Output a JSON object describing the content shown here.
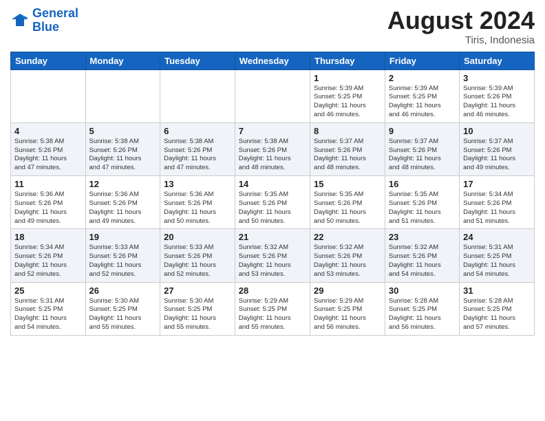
{
  "header": {
    "logo_line1": "General",
    "logo_line2": "Blue",
    "month_year": "August 2024",
    "location": "Tiris, Indonesia"
  },
  "weekdays": [
    "Sunday",
    "Monday",
    "Tuesday",
    "Wednesday",
    "Thursday",
    "Friday",
    "Saturday"
  ],
  "weeks": [
    [
      {
        "day": "",
        "info": ""
      },
      {
        "day": "",
        "info": ""
      },
      {
        "day": "",
        "info": ""
      },
      {
        "day": "",
        "info": ""
      },
      {
        "day": "1",
        "info": "Sunrise: 5:39 AM\nSunset: 5:25 PM\nDaylight: 11 hours\nand 46 minutes."
      },
      {
        "day": "2",
        "info": "Sunrise: 5:39 AM\nSunset: 5:25 PM\nDaylight: 11 hours\nand 46 minutes."
      },
      {
        "day": "3",
        "info": "Sunrise: 5:39 AM\nSunset: 5:26 PM\nDaylight: 11 hours\nand 46 minutes."
      }
    ],
    [
      {
        "day": "4",
        "info": "Sunrise: 5:38 AM\nSunset: 5:26 PM\nDaylight: 11 hours\nand 47 minutes."
      },
      {
        "day": "5",
        "info": "Sunrise: 5:38 AM\nSunset: 5:26 PM\nDaylight: 11 hours\nand 47 minutes."
      },
      {
        "day": "6",
        "info": "Sunrise: 5:38 AM\nSunset: 5:26 PM\nDaylight: 11 hours\nand 47 minutes."
      },
      {
        "day": "7",
        "info": "Sunrise: 5:38 AM\nSunset: 5:26 PM\nDaylight: 11 hours\nand 48 minutes."
      },
      {
        "day": "8",
        "info": "Sunrise: 5:37 AM\nSunset: 5:26 PM\nDaylight: 11 hours\nand 48 minutes."
      },
      {
        "day": "9",
        "info": "Sunrise: 5:37 AM\nSunset: 5:26 PM\nDaylight: 11 hours\nand 48 minutes."
      },
      {
        "day": "10",
        "info": "Sunrise: 5:37 AM\nSunset: 5:26 PM\nDaylight: 11 hours\nand 49 minutes."
      }
    ],
    [
      {
        "day": "11",
        "info": "Sunrise: 5:36 AM\nSunset: 5:26 PM\nDaylight: 11 hours\nand 49 minutes."
      },
      {
        "day": "12",
        "info": "Sunrise: 5:36 AM\nSunset: 5:26 PM\nDaylight: 11 hours\nand 49 minutes."
      },
      {
        "day": "13",
        "info": "Sunrise: 5:36 AM\nSunset: 5:26 PM\nDaylight: 11 hours\nand 50 minutes."
      },
      {
        "day": "14",
        "info": "Sunrise: 5:35 AM\nSunset: 5:26 PM\nDaylight: 11 hours\nand 50 minutes."
      },
      {
        "day": "15",
        "info": "Sunrise: 5:35 AM\nSunset: 5:26 PM\nDaylight: 11 hours\nand 50 minutes."
      },
      {
        "day": "16",
        "info": "Sunrise: 5:35 AM\nSunset: 5:26 PM\nDaylight: 11 hours\nand 51 minutes."
      },
      {
        "day": "17",
        "info": "Sunrise: 5:34 AM\nSunset: 5:26 PM\nDaylight: 11 hours\nand 51 minutes."
      }
    ],
    [
      {
        "day": "18",
        "info": "Sunrise: 5:34 AM\nSunset: 5:26 PM\nDaylight: 11 hours\nand 52 minutes."
      },
      {
        "day": "19",
        "info": "Sunrise: 5:33 AM\nSunset: 5:26 PM\nDaylight: 11 hours\nand 52 minutes."
      },
      {
        "day": "20",
        "info": "Sunrise: 5:33 AM\nSunset: 5:26 PM\nDaylight: 11 hours\nand 52 minutes."
      },
      {
        "day": "21",
        "info": "Sunrise: 5:32 AM\nSunset: 5:26 PM\nDaylight: 11 hours\nand 53 minutes."
      },
      {
        "day": "22",
        "info": "Sunrise: 5:32 AM\nSunset: 5:26 PM\nDaylight: 11 hours\nand 53 minutes."
      },
      {
        "day": "23",
        "info": "Sunrise: 5:32 AM\nSunset: 5:26 PM\nDaylight: 11 hours\nand 54 minutes."
      },
      {
        "day": "24",
        "info": "Sunrise: 5:31 AM\nSunset: 5:25 PM\nDaylight: 11 hours\nand 54 minutes."
      }
    ],
    [
      {
        "day": "25",
        "info": "Sunrise: 5:31 AM\nSunset: 5:25 PM\nDaylight: 11 hours\nand 54 minutes."
      },
      {
        "day": "26",
        "info": "Sunrise: 5:30 AM\nSunset: 5:25 PM\nDaylight: 11 hours\nand 55 minutes."
      },
      {
        "day": "27",
        "info": "Sunrise: 5:30 AM\nSunset: 5:25 PM\nDaylight: 11 hours\nand 55 minutes."
      },
      {
        "day": "28",
        "info": "Sunrise: 5:29 AM\nSunset: 5:25 PM\nDaylight: 11 hours\nand 55 minutes."
      },
      {
        "day": "29",
        "info": "Sunrise: 5:29 AM\nSunset: 5:25 PM\nDaylight: 11 hours\nand 56 minutes."
      },
      {
        "day": "30",
        "info": "Sunrise: 5:28 AM\nSunset: 5:25 PM\nDaylight: 11 hours\nand 56 minutes."
      },
      {
        "day": "31",
        "info": "Sunrise: 5:28 AM\nSunset: 5:25 PM\nDaylight: 11 hours\nand 57 minutes."
      }
    ]
  ]
}
